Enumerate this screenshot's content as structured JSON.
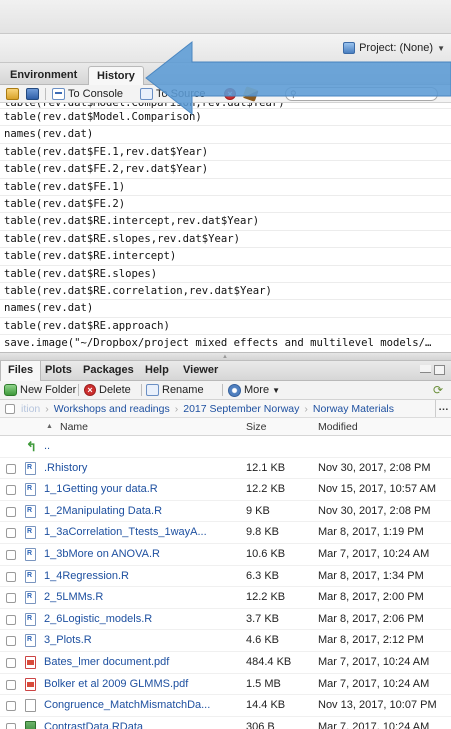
{
  "project": {
    "label": "Project: (None)"
  },
  "upper_tabs": [
    "Environment",
    "History"
  ],
  "history_toolbar": {
    "to_console": "To Console",
    "to_source": "To Source"
  },
  "history": [
    "table(rev.dat$Model.Comparison,rev.dat$Year)",
    "table(rev.dat$Model.Comparison)",
    "names(rev.dat)",
    "table(rev.dat$FE.1,rev.dat$Year)",
    "table(rev.dat$FE.2,rev.dat$Year)",
    "table(rev.dat$FE.1)",
    "table(rev.dat$FE.2)",
    "table(rev.dat$RE.intercept,rev.dat$Year)",
    "table(rev.dat$RE.slopes,rev.dat$Year)",
    "table(rev.dat$RE.intercept)",
    "table(rev.dat$RE.slopes)",
    "table(rev.dat$RE.correlation,rev.dat$Year)",
    "names(rev.dat)",
    "table(rev.dat$RE.approach)",
    "save.image(\"~/Dropbox/project mixed effects and multilevel models/…"
  ],
  "lower_tabs": [
    "Files",
    "Plots",
    "Packages",
    "Help",
    "Viewer"
  ],
  "files_toolbar": {
    "new_folder": "New Folder",
    "delete": "Delete",
    "rename": "Rename",
    "more": "More"
  },
  "breadcrumb": [
    "ition",
    "Workshops and readings",
    "2017 September Norway",
    "Norway Materials"
  ],
  "breadcrumb_more": "…",
  "columns": {
    "name": "Name",
    "size": "Size",
    "modified": "Modified"
  },
  "parent_dir": "..",
  "files": [
    {
      "name": ".Rhistory",
      "size": "12.1 KB",
      "modified": "Nov 30, 2017, 2:08 PM",
      "icon": "r-file-icon"
    },
    {
      "name": "1_1Getting your data.R",
      "size": "12.2 KB",
      "modified": "Nov 15, 2017, 10:57 AM",
      "icon": "r-file-icon"
    },
    {
      "name": "1_2Manipulating Data.R",
      "size": "9 KB",
      "modified": "Nov 30, 2017, 2:08 PM",
      "icon": "r-file-icon"
    },
    {
      "name": "1_3aCorrelation_Ttests_1wayA...",
      "size": "9.8 KB",
      "modified": "Mar 8, 2017, 1:19 PM",
      "icon": "r-file-icon"
    },
    {
      "name": "1_3bMore on ANOVA.R",
      "size": "10.6 KB",
      "modified": "Mar 7, 2017, 10:24 AM",
      "icon": "r-file-icon"
    },
    {
      "name": "1_4Regression.R",
      "size": "6.3 KB",
      "modified": "Mar 8, 2017, 1:34 PM",
      "icon": "r-file-icon"
    },
    {
      "name": "2_5LMMs.R",
      "size": "12.2 KB",
      "modified": "Mar 8, 2017, 2:00 PM",
      "icon": "r-file-icon"
    },
    {
      "name": "2_6Logistic_models.R",
      "size": "3.7 KB",
      "modified": "Mar 8, 2017, 2:06 PM",
      "icon": "r-file-icon"
    },
    {
      "name": "3_Plots.R",
      "size": "4.6 KB",
      "modified": "Mar 8, 2017, 2:12 PM",
      "icon": "r-file-icon"
    },
    {
      "name": "Bates_lmer document.pdf",
      "size": "484.4 KB",
      "modified": "Mar 7, 2017, 10:24 AM",
      "icon": "pdf-icon"
    },
    {
      "name": "Bolker et al 2009 GLMMS.pdf",
      "size": "1.5 MB",
      "modified": "Mar 7, 2017, 10:24 AM",
      "icon": "pdf-icon"
    },
    {
      "name": "Congruence_MatchMismatchDa...",
      "size": "14.4 KB",
      "modified": "Nov 13, 2017, 10:07 PM",
      "icon": "blank-file-icon"
    },
    {
      "name": "ContrastData.RData",
      "size": "306 B",
      "modified": "Mar 7, 2017, 10:24 AM",
      "icon": "rdata-icon"
    },
    {
      "name": "",
      "size": "",
      "modified": "",
      "icon": "pdf-icon"
    }
  ],
  "colors": {
    "link": "#1e50a0",
    "arrow": "#5b9bd5"
  }
}
